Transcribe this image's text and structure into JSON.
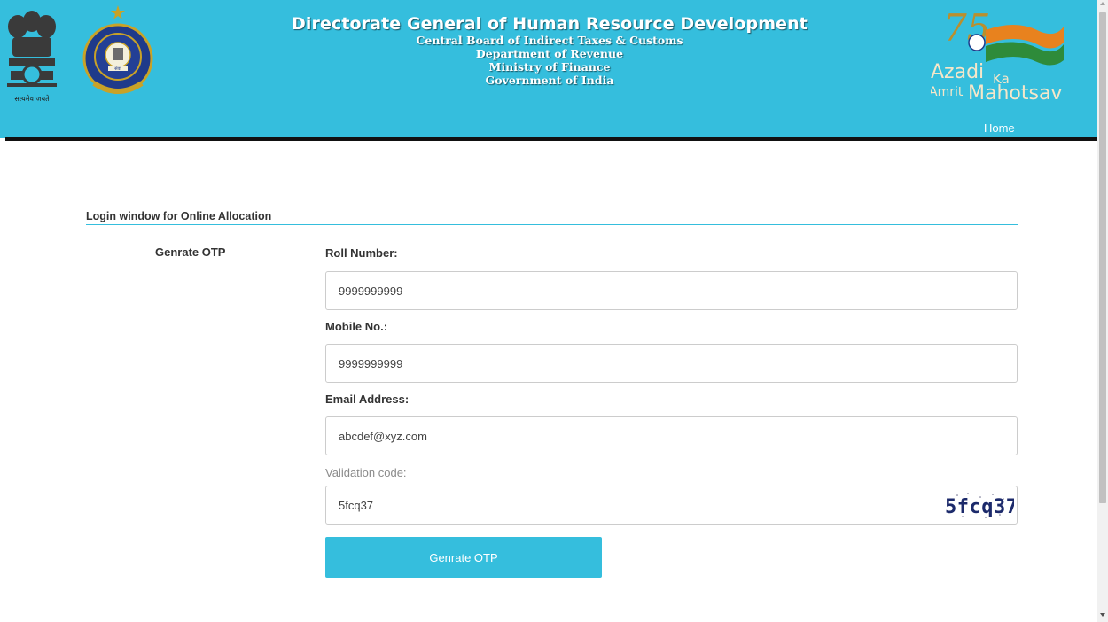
{
  "header": {
    "title": "Directorate General of Human Resource Development",
    "lines": [
      "Central Board of Indirect Taxes & Customs",
      "Department of Revenue",
      "Ministry of Finance",
      "Government of India"
    ],
    "emblem_motto": "सत्यमेव जयते",
    "seal_text": "सेवा",
    "azadi": {
      "line1": "Azadi",
      "line2": "Ka",
      "line3": "Amrit",
      "line4": "Mahotsav",
      "number": "75"
    },
    "nav_home": "Home"
  },
  "form": {
    "section_title": "Login window for Online Allocation",
    "side_label": "Genrate OTP",
    "roll_label": "Roll Number:",
    "roll_value": "9999999999",
    "mobile_label": "Mobile No.:",
    "mobile_value": "9999999999",
    "email_label": "Email Address:",
    "email_value": "abcdef@xyz.com",
    "validation_label": "Validation code:",
    "validation_value": "5fcq37",
    "captcha_text": "5fcq37",
    "submit_label": "Genrate OTP"
  },
  "colors": {
    "brand": "#35bedd",
    "header_rule": "#111111",
    "text": "#333333",
    "saffron": "#e8821e",
    "green": "#2e8b3a"
  },
  "icons": [
    "national-emblem-icon",
    "cbic-seal-icon",
    "azadi-ka-amrit-mahotsav-logo"
  ]
}
